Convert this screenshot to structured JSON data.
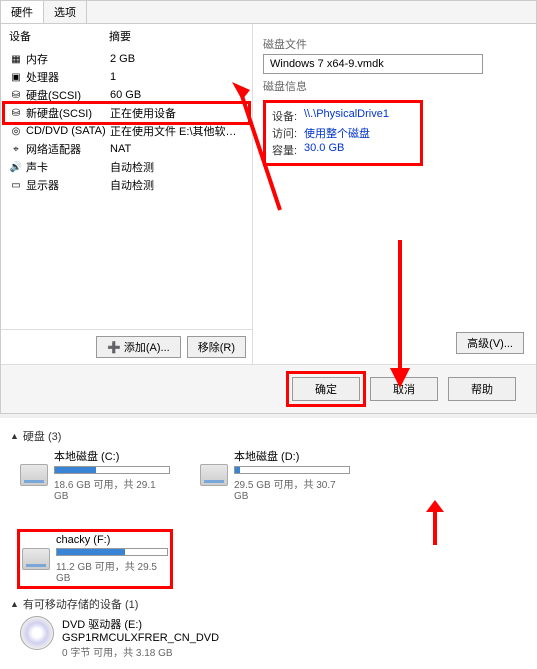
{
  "tabs": {
    "t1": "硬件",
    "t2": "选项"
  },
  "headers": {
    "device": "设备",
    "summary": "摘要"
  },
  "devices": [
    {
      "icon": "▦",
      "name": "内存",
      "summary": "2 GB"
    },
    {
      "icon": "▣",
      "name": "处理器",
      "summary": "1"
    },
    {
      "icon": "⛁",
      "name": "硬盘(SCSI)",
      "summary": "60 GB"
    },
    {
      "icon": "⛁",
      "name": "新硬盘(SCSI)",
      "summary": "正在使用设备",
      "hl": true
    },
    {
      "icon": "◎",
      "name": "CD/DVD (SATA)",
      "summary": "正在使用文件 E:\\其他软件\\操作系统..."
    },
    {
      "icon": "⌖",
      "name": "网络适配器",
      "summary": "NAT"
    },
    {
      "icon": "🔊",
      "name": "声卡",
      "summary": "自动检测"
    },
    {
      "icon": "▭",
      "name": "显示器",
      "summary": "自动检测"
    }
  ],
  "right": {
    "diskfile_label": "磁盘文件",
    "diskfile": "Windows 7 x64-9.vmdk",
    "info_label": "磁盘信息",
    "info": [
      {
        "k": "设备:",
        "v": "\\\\.\\PhysicalDrive1"
      },
      {
        "k": "访问:",
        "v": "使用整个磁盘"
      },
      {
        "k": "容量:",
        "v": "30.0 GB"
      }
    ],
    "advanced": "高级(V)..."
  },
  "left_buttons": {
    "add": "添加(A)...",
    "remove": "移除(R)"
  },
  "dlg_buttons": {
    "ok": "确定",
    "cancel": "取消",
    "help": "帮助"
  },
  "explorer": {
    "disks_label": "硬盘 (3)",
    "removable_label": "有可移动存储的设备 (1)",
    "drives": [
      {
        "name": "本地磁盘 (C:)",
        "sub": "18.6 GB 可用，共 29.1 GB",
        "fill": 36
      },
      {
        "name": "本地磁盘 (D:)",
        "sub": "29.5 GB 可用，共 30.7 GB",
        "fill": 4
      },
      {
        "name": "chacky (F:)",
        "sub": "11.2 GB 可用，共 29.5 GB",
        "fill": 62,
        "hl": true
      }
    ],
    "dvd": {
      "name": "DVD 驱动器 (E:)",
      "line2": "GSP1RMCULXFRER_CN_DVD",
      "line3": "0 字节 可用，共 3.18 GB"
    }
  }
}
